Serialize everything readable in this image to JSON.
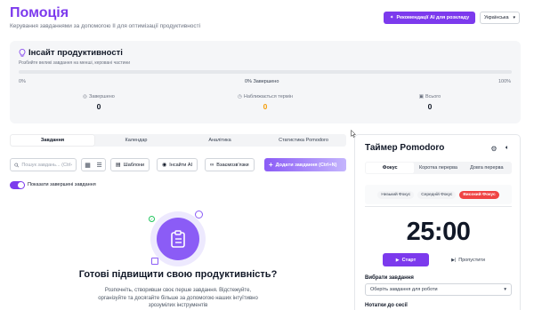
{
  "header": {
    "title": "Помоція",
    "subtitle": "Керування завданнями за допомогою ІІ для оптимізації продуктивності",
    "reco_button": "Рекомендації AI для розкладу",
    "language": "Українська"
  },
  "insight": {
    "title": "Інсайт продуктивності",
    "subtitle": "Розбийте великі завдання на менші, керовані частини",
    "progress_fraction": 0,
    "progress_left": "0%",
    "progress_mid": "0% Завершено",
    "progress_right": "100%",
    "stats": [
      {
        "label": "Завершено",
        "value": "0",
        "color": "#111827"
      },
      {
        "label": "Наближається термін",
        "value": "0",
        "color": "#f59e0b"
      },
      {
        "label": "Всього",
        "value": "0",
        "color": "#111827"
      }
    ]
  },
  "tabs": [
    "Завдання",
    "Календар",
    "Аналітика",
    "Статистика Pomodoro"
  ],
  "toolbar": {
    "search_placeholder": "Пошук завдань... (Ctrl+K)",
    "templates": "Шаблони",
    "insights": "Інсайти AI",
    "relations": "Взаємозв'язки",
    "add_task": "Додати завдання (Ctrl+N)"
  },
  "toggle": {
    "label": "Показати завершені завдання",
    "on": true
  },
  "empty": {
    "title": "Готові підвищити свою продуктивність?",
    "text": "Розпочніть, створивши своє перше завдання. Відстежуйте, організуйте та досягайте більше за допомогою наших інтуїтивно зрозумілих інструментів"
  },
  "pomodoro": {
    "title": "Таймер Pomodoro",
    "tabs": [
      "Фокус",
      "Коротка перерва",
      "Довга перерва"
    ],
    "intensity": [
      "Низький Фокус",
      "Середній Фокус",
      "Високий Фокус"
    ],
    "time": "25:00",
    "start": "Старт",
    "skip": "Пропустити",
    "task_label": "Вибрати завдання",
    "task_select": "Оберіть завдання для роботи",
    "notes_label": "Нотатки до сесії"
  },
  "colors": {
    "accent": "#7c3aed",
    "warning": "#f59e0b",
    "high_focus": "#ef4444"
  }
}
